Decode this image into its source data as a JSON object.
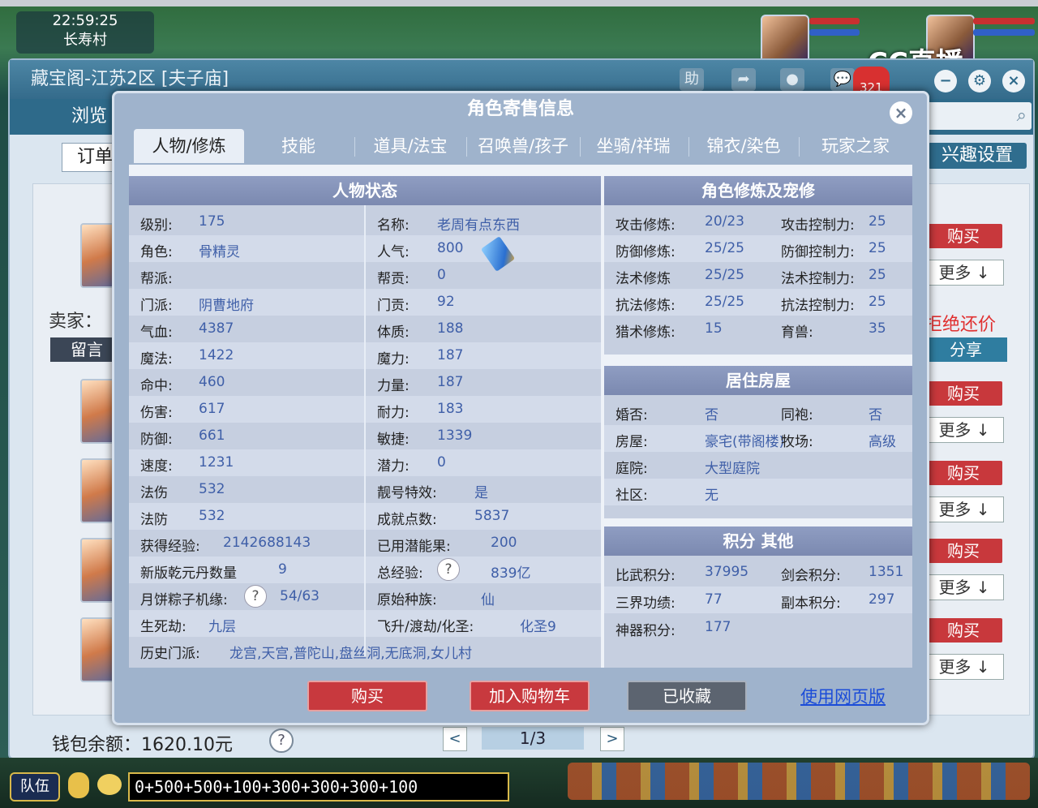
{
  "game": {
    "clock": "22:59:25",
    "location": "长寿村",
    "stream_logo": "CC直播",
    "chat_input": "0+500+500+100+300+300+300+100",
    "team_button": "队伍"
  },
  "zangbaoge": {
    "window_title": "藏宝阁-江苏2区 [夫子庙]",
    "notification_count": "321",
    "browse_tab": "浏览",
    "order_box": "订单",
    "interest_button": "兴趣设置",
    "seller_label": "卖家：",
    "message_button": "留言",
    "refuse_bargain": "拒绝还价",
    "share_button": "分享",
    "buy_label": "购买",
    "more_label": "更多",
    "wallet_label": "钱包余额：",
    "wallet_value": "1620.10元",
    "help": "?",
    "page": "1/3"
  },
  "modal": {
    "title": "角色寄售信息",
    "close": "×",
    "tabs": [
      "人物/修炼",
      "技能",
      "道具/法宝",
      "召唤兽/孩子",
      "坐骑/祥瑞",
      "锦衣/染色",
      "玩家之家"
    ],
    "status_header": "人物状态",
    "cultivation_header": "角色修炼及宠修",
    "housing_header": "居住房屋",
    "points_header": "积分 其他",
    "status_left": [
      {
        "k": "级别:",
        "v": "175"
      },
      {
        "k": "角色:",
        "v": "骨精灵"
      },
      {
        "k": "帮派:",
        "v": ""
      },
      {
        "k": "门派:",
        "v": "阴曹地府"
      },
      {
        "k": "气血:",
        "v": "4387"
      },
      {
        "k": "魔法:",
        "v": "1422"
      },
      {
        "k": "命中:",
        "v": "460"
      },
      {
        "k": "伤害:",
        "v": "617"
      },
      {
        "k": "防御:",
        "v": "661"
      },
      {
        "k": "速度:",
        "v": "1231"
      },
      {
        "k": "法伤",
        "v": "532"
      },
      {
        "k": "法防",
        "v": "532"
      },
      {
        "k": "获得经验:",
        "v": "2142688143"
      },
      {
        "k": "新版乾元丹数量",
        "v": "9"
      },
      {
        "k": "月饼粽子机缘:",
        "v": "54/63"
      },
      {
        "k": "生死劫:",
        "v": "九层"
      },
      {
        "k": "历史门派:",
        "v": "龙宫,天宫,普陀山,盘丝洞,无底洞,女儿村"
      }
    ],
    "status_right": [
      {
        "k": "名称:",
        "v": "老周有点东西"
      },
      {
        "k": "人气:",
        "v": "800"
      },
      {
        "k": "帮贡:",
        "v": "0"
      },
      {
        "k": "门贡:",
        "v": "92"
      },
      {
        "k": "体质:",
        "v": "188"
      },
      {
        "k": "魔力:",
        "v": "187"
      },
      {
        "k": "力量:",
        "v": "187"
      },
      {
        "k": "耐力:",
        "v": "183"
      },
      {
        "k": "敏捷:",
        "v": "1339"
      },
      {
        "k": "潜力:",
        "v": "0"
      },
      {
        "k": "靓号特效:",
        "v": "是"
      },
      {
        "k": "成就点数:",
        "v": "5837"
      },
      {
        "k": "已用潜能果:",
        "v": "200"
      },
      {
        "k": "总经验:",
        "v": "839亿"
      },
      {
        "k": "原始种族:",
        "v": "仙"
      },
      {
        "k": "飞升/渡劫/化圣:",
        "v": "化圣9"
      }
    ],
    "cultivation": [
      {
        "k1": "攻击修炼:",
        "v1": "20/23",
        "k2": "攻击控制力:",
        "v2": "25"
      },
      {
        "k1": "防御修炼:",
        "v1": "25/25",
        "k2": "防御控制力:",
        "v2": "25"
      },
      {
        "k1": "法术修炼",
        "v1": "25/25",
        "k2": "法术控制力:",
        "v2": "25"
      },
      {
        "k1": "抗法修炼:",
        "v1": "25/25",
        "k2": "抗法控制力:",
        "v2": "25"
      },
      {
        "k1": "猎术修炼:",
        "v1": "15",
        "k2": "育兽:",
        "v2": "35"
      }
    ],
    "housing": [
      {
        "k1": "婚否:",
        "v1": "否",
        "k2": "同袍:",
        "v2": "否"
      },
      {
        "k1": "房屋:",
        "v1": "豪宅(带阁楼)",
        "k2": "牧场:",
        "v2": "高级"
      },
      {
        "k1": "庭院:",
        "v1": "大型庭院",
        "k2": "",
        "v2": ""
      },
      {
        "k1": "社区:",
        "v1": "无",
        "k2": "",
        "v2": ""
      }
    ],
    "points": [
      {
        "k1": "比武积分:",
        "v1": "37995",
        "k2": "剑会积分:",
        "v2": "1351"
      },
      {
        "k1": "三界功绩:",
        "v1": "77",
        "k2": "副本积分:",
        "v2": "297"
      },
      {
        "k1": "神器积分:",
        "v1": "177",
        "k2": "",
        "v2": ""
      }
    ],
    "buttons": {
      "buy": "购买",
      "add_cart": "加入购物车",
      "favorited": "已收藏",
      "web_version": "使用网页版"
    }
  },
  "colors": {
    "buy_red": "#c8393e",
    "value_blue": "#3f5fa8",
    "panel_header": "#8592b8",
    "link_blue": "#1b4cd8"
  }
}
